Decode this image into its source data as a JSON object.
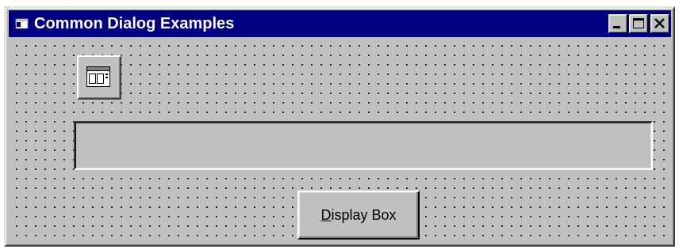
{
  "window": {
    "title": "Common Dialog Examples",
    "titlebar_color": "#000080",
    "face_color": "#c0c0c0",
    "grid_style": "dotted design-time grid"
  },
  "titlebar_buttons": {
    "minimize_icon": "minimize-icon",
    "maximize_icon": "maximize-icon",
    "close_icon": "close-icon"
  },
  "controls": {
    "common_dialog_icon": "common-dialog-icon",
    "text_box_value": "",
    "display_button": {
      "accel_key": "D",
      "rest_label": "isplay Box"
    }
  }
}
